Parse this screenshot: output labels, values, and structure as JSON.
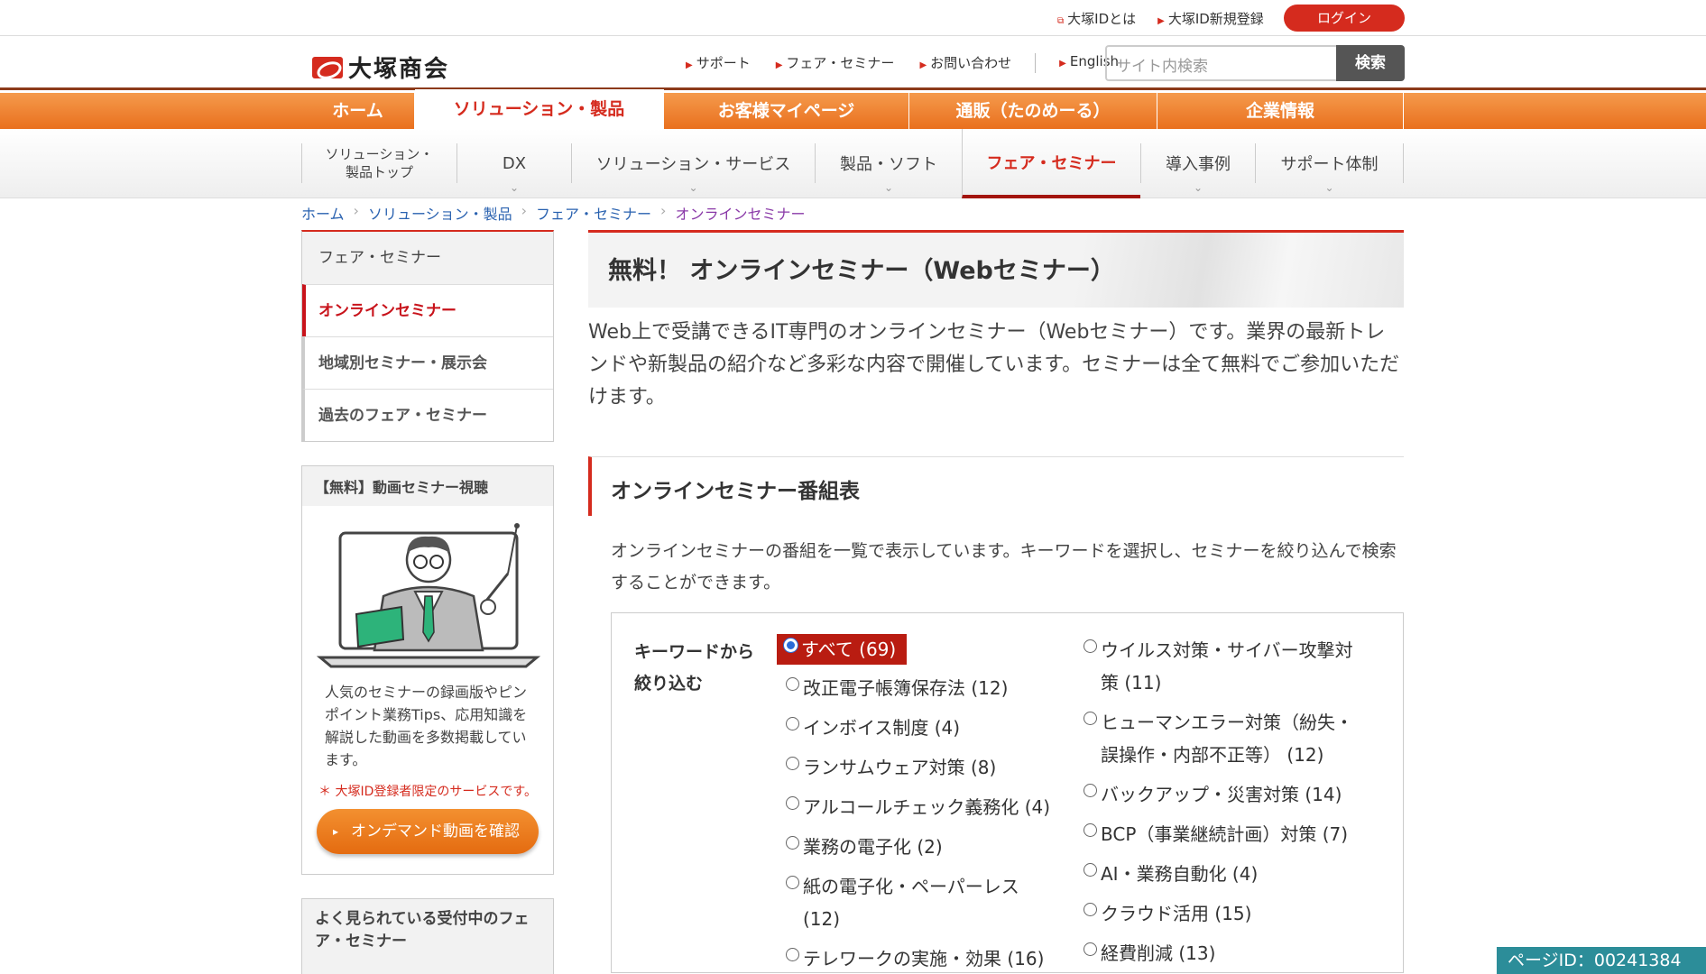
{
  "topbar": {
    "links": [
      "大塚IDとは",
      "大塚ID新規登録"
    ],
    "login": "ログイン"
  },
  "header": {
    "logo": "大塚商会",
    "nav": [
      "サポート",
      "フェア・セミナー",
      "お問い合わせ",
      "English"
    ],
    "search_placeholder": "サイト内検索",
    "search_button": "検索"
  },
  "main_nav": [
    "ホーム",
    "ソリューション・製品",
    "お客様マイページ",
    "通販（たのめーる）",
    "企業情報"
  ],
  "main_nav_active": 1,
  "sub_nav": {
    "first": [
      "ソリューション・",
      "製品トップ"
    ],
    "items": [
      "DX",
      "ソリューション・サービス",
      "製品・ソフト",
      "フェア・セミナー",
      "導入事例",
      "サポート体制"
    ]
  },
  "breadcrumb": [
    "ホーム",
    "ソリューション・製品",
    "フェア・セミナー",
    "オンラインセミナー"
  ],
  "side_nav": [
    "フェア・セミナー",
    "オンラインセミナー",
    "地域別セミナー・展示会",
    "過去のフェア・セミナー"
  ],
  "video_box": {
    "heading": "【無料】動画セミナー視聴",
    "desc": "人気のセミナーの録画版やピンポイント業務Tips、応用知識を解説した動画を多数掲載しています。",
    "note": "＊ 大塚ID登録者限定のサービスです。",
    "button": "オンデマンド動画を確認"
  },
  "popular_box": {
    "heading": "よく見られている受付中のフェア・セミナー"
  },
  "main": {
    "title": "無料！ オンラインセミナー（Webセミナー）",
    "intro": "Web上で受講できるIT専門のオンラインセミナー（Webセミナー）です。業界の最新トレンドや新製品の紹介など多彩な内容で開催しています。セミナーは全て無料でご参加いただけます。",
    "section_title": "オンラインセミナー番組表",
    "lead": "オンラインセミナーの番組を一覧で表示しています。キーワードを選択し、セミナーを絞り込んで検索することができます。",
    "filter_label": "キーワードから絞り込む",
    "options_left": [
      "すべて (69)",
      "改正電子帳簿保存法 (12)",
      "インボイス制度 (4)",
      "ランサムウェア対策 (8)",
      "アルコールチェック義務化 (4)",
      "業務の電子化 (2)",
      "紙の電子化・ペーパーレス (12)",
      "テレワークの実施・効果 (16)"
    ],
    "options_right": [
      "ウイルス対策・サイバー攻撃対策 (11)",
      "ヒューマンエラー対策（紛失・誤操作・内部不正等） (12)",
      "バックアップ・災害対策 (14)",
      "BCP（事業継続計画）対策 (7)",
      "AI・業務自動化 (4)",
      "クラウド活用 (15)",
      "経費削減 (13)"
    ],
    "selected": "すべて (69)"
  },
  "page_id": "ページID：00241384",
  "colors": {
    "brand_red": "#d52b1e",
    "nav_orange": "#f08033",
    "page_id_bg": "#2c8d99"
  }
}
